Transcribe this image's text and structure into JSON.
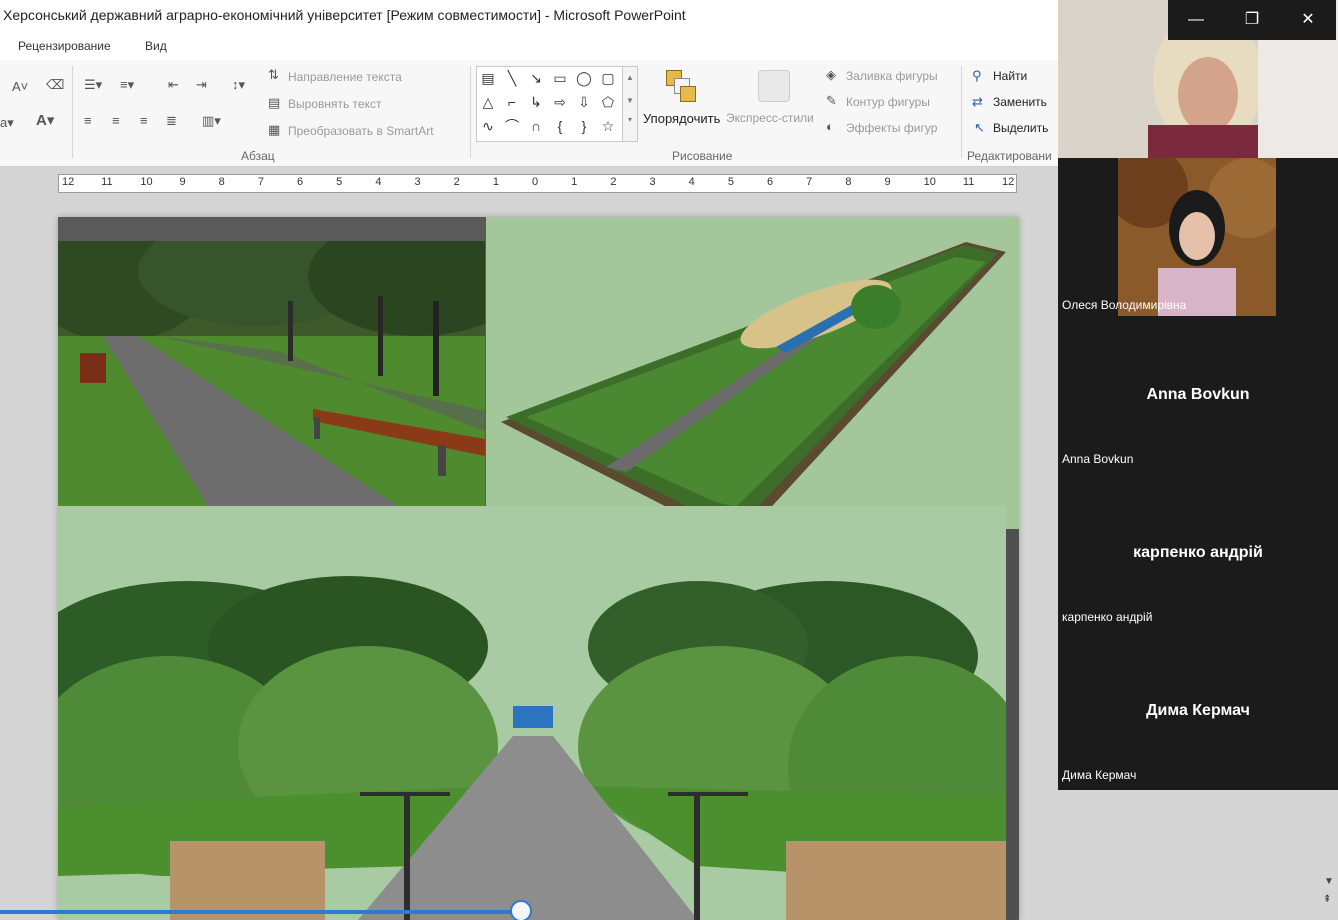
{
  "window": {
    "title": "Херсонський державний аграрно-економічний університет [Режим совместимости]  -  Microsoft PowerPoint"
  },
  "tabs": [
    {
      "label": "Рецензирование"
    },
    {
      "label": "Вид"
    }
  ],
  "ribbon": {
    "paragraph": {
      "text_direction": "Направление текста",
      "align_text": "Выровнять текст",
      "convert_smartart": "Преобразовать в SmartArt",
      "group_label": "Абзац"
    },
    "drawing": {
      "arrange": "Упорядочить",
      "quick_styles": "Экспресс-стили",
      "shape_fill": "Заливка фигуры",
      "shape_outline": "Контур фигуры",
      "shape_effects": "Эффекты фигур",
      "group_label": "Рисование"
    },
    "editing": {
      "find": "Найти",
      "replace": "Заменить",
      "select": "Выделить",
      "group_label": "Редактировани"
    }
  },
  "ruler": {
    "ticks": [
      "12",
      "11",
      "10",
      "9",
      "8",
      "7",
      "6",
      "5",
      "4",
      "3",
      "2",
      "1",
      "0",
      "1",
      "2",
      "3",
      "4",
      "5",
      "6",
      "7",
      "8",
      "9",
      "10",
      "11",
      "12"
    ]
  },
  "zoom": {
    "participants": [
      {
        "name": "Олеся Володимирівна",
        "video": true
      },
      {
        "name": "Anna Bovkun",
        "video": false
      },
      {
        "name": "карпенко андрій",
        "video": false
      },
      {
        "name": "Дима Кермач",
        "video": false
      }
    ]
  },
  "colors": {
    "zoom_bg": "#1b1b1b",
    "progress": "#2b7bd0"
  }
}
